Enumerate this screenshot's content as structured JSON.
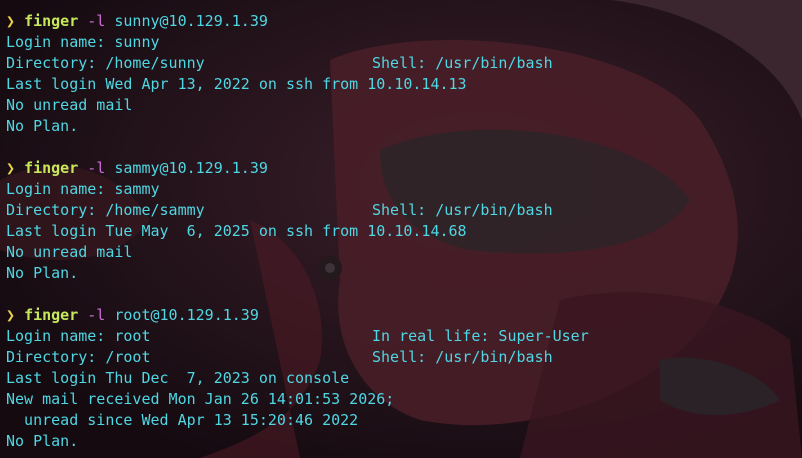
{
  "colors": {
    "background": "#1a0f14",
    "output_text": "#4fd7e3",
    "prompt_arrow": "#e8d24a",
    "command": "#c6e85a",
    "flag": "#d06ad8"
  },
  "blocks": [
    {
      "prompt": "❯",
      "command": "finger",
      "flag": "-l",
      "target": "sunny@10.129.1.39",
      "login_name": "Login name: sunny",
      "login_right": "",
      "directory": "Directory: /home/sunny",
      "shell": "Shell: /usr/bin/bash",
      "last_login": "Last login Wed Apr 13, 2022 on ssh from 10.10.14.13",
      "mail": "No unread mail",
      "plan": "No Plan."
    },
    {
      "prompt": "❯",
      "command": "finger",
      "flag": "-l",
      "target": "sammy@10.129.1.39",
      "login_name": "Login name: sammy",
      "login_right": "",
      "directory": "Directory: /home/sammy",
      "shell": "Shell: /usr/bin/bash",
      "last_login": "Last login Tue May  6, 2025 on ssh from 10.10.14.68",
      "mail": "No unread mail",
      "plan": "No Plan."
    },
    {
      "prompt": "❯",
      "command": "finger",
      "flag": "-l",
      "target": "root@10.129.1.39",
      "login_name": "Login name: root",
      "login_right": "In real life: Super-User",
      "directory": "Directory: /root",
      "shell": "Shell: /usr/bin/bash",
      "last_login": "Last login Thu Dec  7, 2023 on console",
      "mail": "New mail received Mon Jan 26 14:01:53 2026;",
      "mail_extra": "  unread since Wed Apr 13 15:20:46 2022",
      "plan": "No Plan."
    }
  ]
}
